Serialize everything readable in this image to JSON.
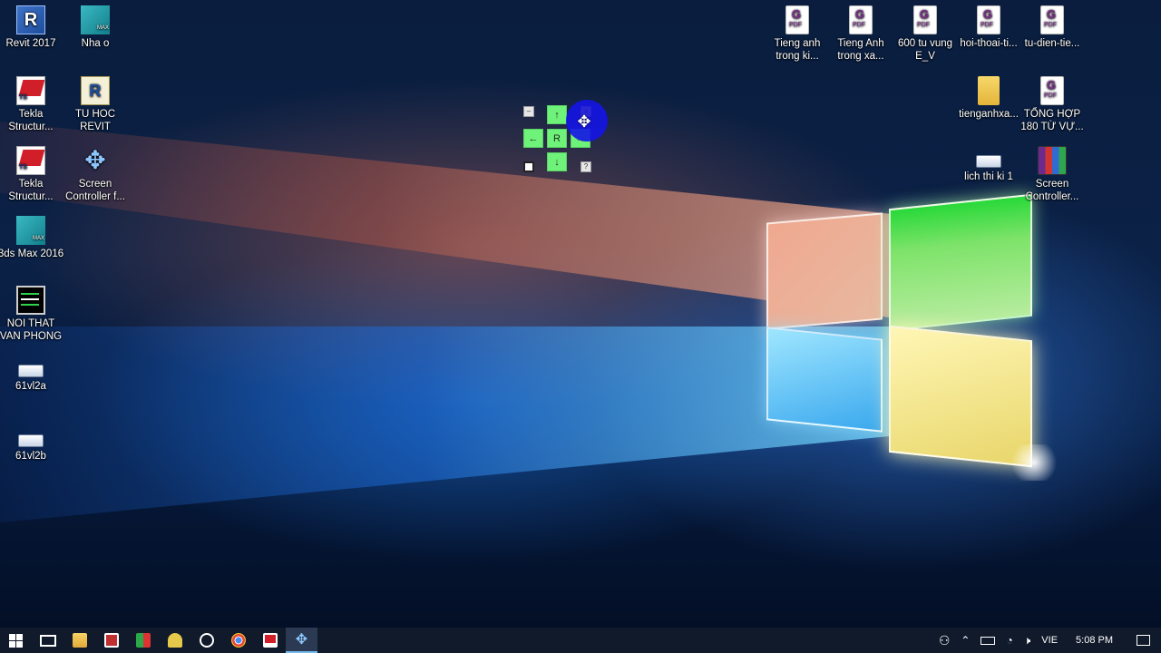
{
  "desktop": {
    "left_icons": [
      {
        "label": "Revit 2017",
        "icon": "revit-icon"
      },
      {
        "label": "Nha o",
        "icon": "3dsmax-icon"
      },
      {
        "label": "Tekla Structur...",
        "icon": "tekla-icon"
      },
      {
        "label": "TU HOC REVIT",
        "icon": "revit-book-icon"
      },
      {
        "label": "Tekla Structur...",
        "icon": "tekla-icon"
      },
      {
        "label": "Screen Controller f...",
        "icon": "move-arrows-icon"
      },
      {
        "label": "3ds Max 2016",
        "icon": "3dsmax-icon"
      },
      {
        "label": "NOI THAT VAN PHONG",
        "icon": "screen-video-icon"
      },
      {
        "label": "61vl2a",
        "icon": "file-icon"
      },
      {
        "label": "61vl2b",
        "icon": "file-icon"
      }
    ],
    "right_icons": [
      {
        "label": "Tieng anh trong ki...",
        "icon": "pdf-icon"
      },
      {
        "label": "Tieng Anh trong xa...",
        "icon": "pdf-icon"
      },
      {
        "label": "600 tu vung E_V",
        "icon": "pdf-icon"
      },
      {
        "label": "hoi-thoai-ti...",
        "icon": "pdf-icon"
      },
      {
        "label": "tu-dien-tie...",
        "icon": "pdf-icon"
      },
      {
        "label": "tienganhxa...",
        "icon": "folder-icon"
      },
      {
        "label": "TỔNG HỢP 180 TỪ VỰ...",
        "icon": "pdf-icon"
      },
      {
        "label": "lich thi ki 1",
        "icon": "file-icon"
      },
      {
        "label": "Screen Controller...",
        "icon": "winrar-icon"
      }
    ]
  },
  "controller": {
    "up": "↑",
    "down": "↓",
    "left": "←",
    "right": "→",
    "center": "R",
    "minimize": "–",
    "close": "x",
    "help": "?",
    "stop": "■"
  },
  "taskbar": {
    "apps": [
      "file-explorer-icon",
      "app-icon",
      "app-icon",
      "app-icon",
      "app-icon",
      "chrome-icon",
      "tekla-icon",
      "screen-controller-icon"
    ],
    "tray": {
      "language": "VIE",
      "time": "5:08 PM"
    }
  },
  "colors": {
    "controller_green": "#6ff27a",
    "taskbar_bg": "#101a2a",
    "cursor_blue": "#1414e6"
  }
}
